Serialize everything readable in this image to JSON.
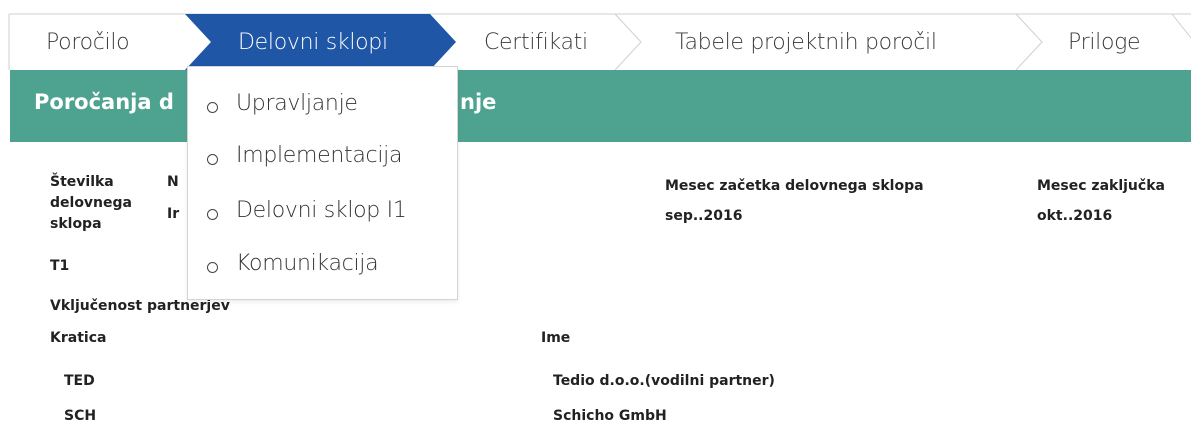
{
  "steps": {
    "items": [
      {
        "label": "Poročilo"
      },
      {
        "label": "Delovni sklopi"
      },
      {
        "label": "Certifikati"
      },
      {
        "label": "Tabele projektnih poročil"
      },
      {
        "label": "Priloge"
      }
    ],
    "active_index": 1
  },
  "section": {
    "title_start": "Poročanja d",
    "title_end": "nje"
  },
  "details": {
    "wp_number_label": [
      "Številka",
      "delovnega",
      "sklopa"
    ],
    "wp_number_value": "T1",
    "name_label_partial": "N",
    "name_value_partial": "Ir",
    "start_month_label": "Mesec začetka delovnega sklopa",
    "start_month_value": "sep..2016",
    "end_month_label": "Mesec zaključka",
    "end_month_value": "okt..2016",
    "partners_heading_start": "Vključenost pa",
    "partners_heading_end": "rtnerjev"
  },
  "partners_table": {
    "columns": [
      "Kratica",
      "Ime"
    ],
    "rows": [
      {
        "abbr": "TED",
        "name": "Tedio d.o.o.(vodilni partner)"
      },
      {
        "abbr": "SCH",
        "name": "Schicho GmbH"
      }
    ]
  },
  "dropdown": {
    "items": [
      {
        "label": "Upravljanje"
      },
      {
        "label": "Implementacija"
      },
      {
        "label": "Delovni sklop I1"
      },
      {
        "label": "Komunikacija"
      }
    ]
  },
  "colors": {
    "accent_nav": "#1f56a6",
    "section_bar": "#4ea390",
    "step_border": "#cfcfcf"
  }
}
